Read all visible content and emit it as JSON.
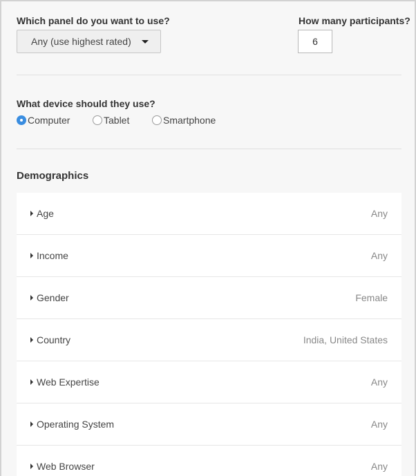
{
  "panel": {
    "label": "Which panel do you want to use?",
    "selected": "Any (use highest rated)",
    "dropdown_icon": "caret-down-icon"
  },
  "participants": {
    "label": "How many participants?",
    "value": "6"
  },
  "device": {
    "label": "What device should they use?",
    "options": [
      {
        "label": "Computer",
        "checked": true
      },
      {
        "label": "Tablet",
        "checked": false
      },
      {
        "label": "Smartphone",
        "checked": false
      }
    ]
  },
  "demographics": {
    "title": "Demographics",
    "expand_icon": "caret-right-icon",
    "rows": [
      {
        "label": "Age",
        "value": "Any"
      },
      {
        "label": "Income",
        "value": "Any"
      },
      {
        "label": "Gender",
        "value": "Female"
      },
      {
        "label": "Country",
        "value": "India, United States"
      },
      {
        "label": "Web Expertise",
        "value": "Any"
      },
      {
        "label": "Operating System",
        "value": "Any"
      },
      {
        "label": "Web Browser",
        "value": "Any"
      }
    ]
  },
  "colors": {
    "accent": "#3a8de0",
    "background": "#f7f7f7",
    "row_background": "#ffffff"
  }
}
